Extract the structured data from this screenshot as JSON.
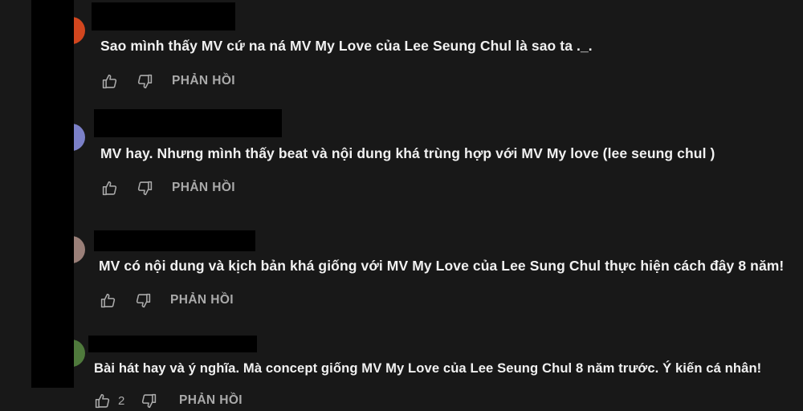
{
  "colors": {
    "background": "#181818",
    "text": "#f1f1f1",
    "secondary": "#aaaaaa",
    "redaction": "#000000"
  },
  "comments": [
    {
      "text": "Sao mình thấy MV cứ na ná MV My Love của Lee Seung Chul là sao ta ._.",
      "like_count": "",
      "reply_label": "PHẢN HỒI",
      "avatar_color": "#d2461e"
    },
    {
      "text": "MV hay. Nhưng mình thấy beat và nội dung khá trùng hợp với MV My love (lee seung chul )",
      "like_count": "",
      "reply_label": "PHẢN HỒI",
      "avatar_color": "#7b80c8"
    },
    {
      "text": "MV có nội dung và kịch bản khá giống với MV My Love của Lee Sung Chul thực hiện cách đây 8 năm!",
      "like_count": "",
      "reply_label": "PHẢN HỒI",
      "avatar_color": "#9a7f78"
    },
    {
      "text": "Bài hát hay và ý nghĩa. Mà concept giống MV My Love của Lee Seung Chul 8 năm trước. Ý kiến cá nhân!",
      "like_count": "2",
      "reply_label": "PHẢN HỒI",
      "avatar_color": "#4f7a3c"
    }
  ]
}
